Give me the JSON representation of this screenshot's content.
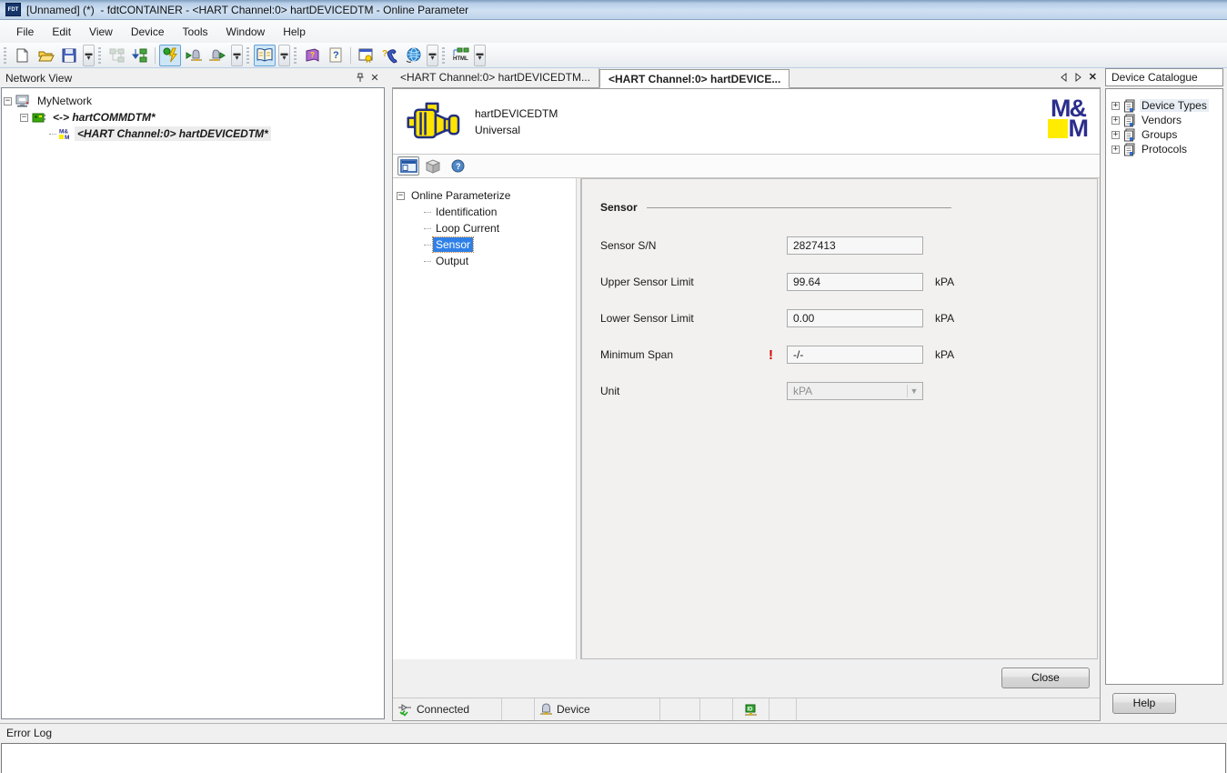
{
  "window": {
    "title": "[Unnamed] (*)  - fdtCONTAINER - <HART Channel:0> hartDEVICEDTM - Online Parameter",
    "logo_text": "FDT"
  },
  "menu": {
    "items": [
      "File",
      "Edit",
      "View",
      "Device",
      "Tools",
      "Window",
      "Help"
    ]
  },
  "network_view": {
    "title": "Network View",
    "nodes": {
      "root": "MyNetwork",
      "comm": "<-> hartCOMMDTM*",
      "device": "<HART Channel:0> hartDEVICEDTM*"
    }
  },
  "tabs": {
    "inactive": "<HART Channel:0> hartDEVICEDTM...",
    "active": "<HART Channel:0> hartDEVICE..."
  },
  "device_header": {
    "name": "hartDEVICEDTM",
    "type": "Universal",
    "logo_top": "M&",
    "logo_bottom": "M"
  },
  "nav_tree": {
    "root": "Online Parameterize",
    "items": [
      "Identification",
      "Loop Current",
      "Sensor",
      "Output"
    ],
    "selected": "Sensor"
  },
  "form": {
    "section_title": "Sensor",
    "fields": [
      {
        "label": "Sensor S/N",
        "value": "2827413",
        "unit": "",
        "alert": ""
      },
      {
        "label": "Upper Sensor Limit",
        "value": "99.64",
        "unit": "kPA",
        "alert": ""
      },
      {
        "label": "Lower Sensor Limit",
        "value": "0.00",
        "unit": "kPA",
        "alert": ""
      },
      {
        "label": "Minimum Span",
        "value": "-/-",
        "unit": "kPA",
        "alert": "!"
      },
      {
        "label": "Unit",
        "value": "kPA",
        "unit": "",
        "alert": ""
      }
    ]
  },
  "buttons": {
    "close": "Close",
    "help": "Help"
  },
  "dtm_status": {
    "connection": "Connected",
    "device": "Device"
  },
  "device_catalogue": {
    "title": "Device Catalogue",
    "items": [
      "Device Types",
      "Vendors",
      "Groups",
      "Protocols"
    ]
  },
  "error_log": {
    "title": "Error Log"
  },
  "colors": {
    "brand_navy": "#2b2e8c",
    "brand_yellow": "#ffec00",
    "selection_blue": "#2f80e7",
    "alert_red": "#d40000",
    "toolbar_highlight": "#cde6f7"
  },
  "icons": {
    "titlebar": "fdt-logo",
    "toolbar": [
      "new-document",
      "open-folder",
      "save",
      "topology-disabled",
      "topology-download",
      "connect",
      "upload-from-device",
      "download-to-device",
      "device-catalogue",
      "manual-book",
      "help-document",
      "license",
      "support-phone",
      "web-globe",
      "html-export"
    ],
    "dtm_toolbar": [
      "parameter-view",
      "offline-cube",
      "help-circle"
    ],
    "dtm_status": [
      "connected-plug",
      "device",
      "device-id"
    ],
    "network_tree": [
      "computer",
      "comm-board",
      "mm-device"
    ],
    "catalogue_tree": "document"
  }
}
